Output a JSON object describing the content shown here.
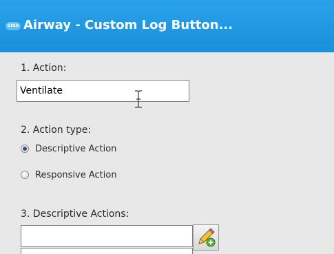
{
  "window": {
    "title": "Airway - Custom Log Button...",
    "logo_text": "GIGA",
    "accent_color": "#1f96e0"
  },
  "form": {
    "action_label": "1. Action:",
    "action_value": "Ventilate",
    "action_type_label": "2. Action type:",
    "action_types": [
      {
        "label": "Descriptive Action",
        "checked": true
      },
      {
        "label": "Responsive Action",
        "checked": false
      }
    ],
    "descriptive_actions_label": "3. Descriptive Actions:",
    "descriptive_actions_value": "",
    "edit_icon": "pencil-add-icon"
  }
}
